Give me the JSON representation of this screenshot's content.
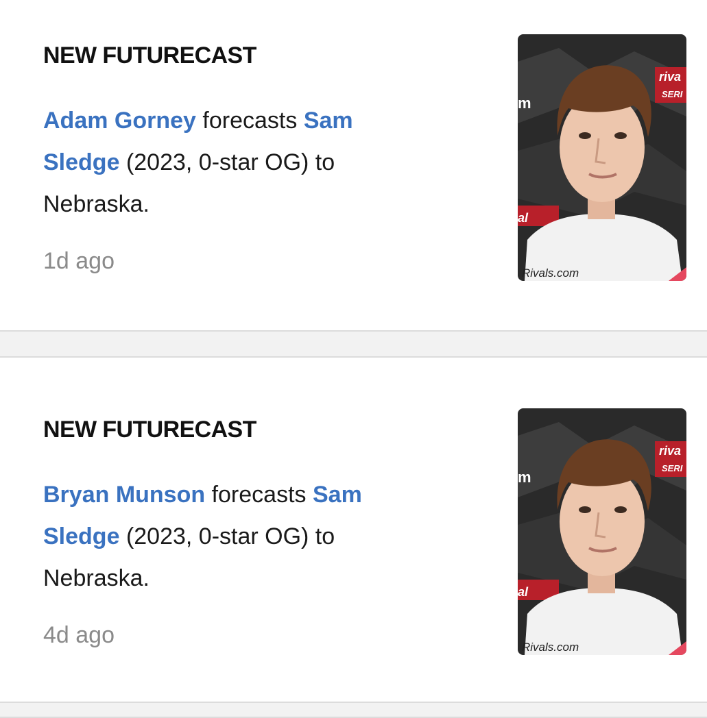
{
  "feed": [
    {
      "title": "NEW FUTURECAST",
      "author": "Adam Gorney",
      "verb": "forecasts",
      "player": "Sam Sledge",
      "details": "(2023, 0-star OG) to Nebraska.",
      "time": "1d ago",
      "photo_watermark": "Rivals.com"
    },
    {
      "title": "NEW FUTURECAST",
      "author": "Bryan Munson",
      "verb": "forecasts",
      "player": "Sam Sledge",
      "details": "(2023, 0-star OG) to Nebraska.",
      "time": "4d ago",
      "photo_watermark": "Rivals.com"
    }
  ],
  "colors": {
    "link": "#3a72c0",
    "timestamp": "#8a8a8a",
    "separator": "#f2f2f2"
  }
}
